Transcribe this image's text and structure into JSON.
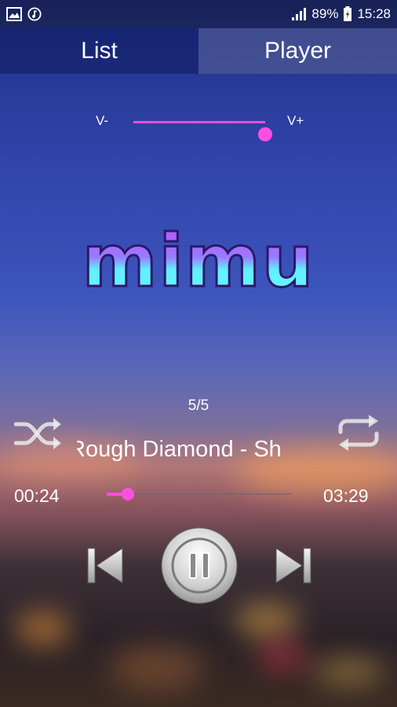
{
  "status_bar": {
    "battery_percent": "89%",
    "time": "15:28",
    "icons": [
      "image-icon",
      "music-note-icon",
      "signal-icon",
      "battery-icon"
    ]
  },
  "tabs": [
    {
      "label": "List",
      "active": true
    },
    {
      "label": "Player",
      "active": false
    }
  ],
  "volume": {
    "minus_label": "V-",
    "plus_label": "V+",
    "level": 1.0
  },
  "logo_text": "mimu",
  "track": {
    "counter": "5/5",
    "title": "Rough Diamond - Sh",
    "current_time": "00:24",
    "total_time": "03:29",
    "progress": 0.115
  },
  "controls": {
    "icons": [
      "shuffle-icon",
      "repeat-icon",
      "previous-icon",
      "pause-icon",
      "next-icon"
    ]
  },
  "colors": {
    "accent": "#ff4fe3",
    "logo_top": "#c04bff",
    "logo_bottom": "#5ff0ff"
  }
}
